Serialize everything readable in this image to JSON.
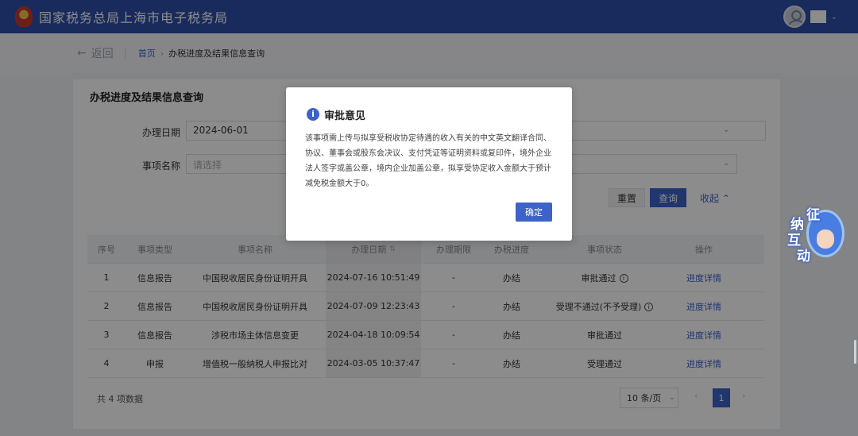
{
  "header": {
    "title": "国家税务总局上海市电子税务局",
    "user_caret": "⌄"
  },
  "breadcrumb": {
    "back_arrow": "←",
    "back_label": "返回",
    "home": "首页",
    "arrow": "›",
    "current": "办税进度及结果信息查询"
  },
  "card": {
    "title": "办税进度及结果信息查询",
    "date_label": "办理日期",
    "date_value": "2024-06-01",
    "item_label": "事项名称",
    "item_placeholder": "请选择",
    "reset_label": "重置",
    "query_label": "查询",
    "collapse_label": "收起 ⌃"
  },
  "table": {
    "headers": [
      "序号",
      "事项类型",
      "事项名称",
      "办理日期",
      "办理期限",
      "办税进度",
      "事项状态",
      "操作"
    ],
    "sort_icon": "⇅",
    "rows": [
      {
        "no": "1",
        "type": "信息报告",
        "name": "中国税收居民身份证明开具",
        "date": "2024-07-16 10:51:49",
        "limit": "-",
        "progress": "办结",
        "status": "审批通过",
        "info": true,
        "action": "进度详情"
      },
      {
        "no": "2",
        "type": "信息报告",
        "name": "中国税收居民身份证明开具",
        "date": "2024-07-09 12:23:43",
        "limit": "-",
        "progress": "办结",
        "status": "受理不通过(不予受理)",
        "info": true,
        "action": "进度详情"
      },
      {
        "no": "3",
        "type": "信息报告",
        "name": "涉税市场主体信息变更",
        "date": "2024-04-18 10:09:54",
        "limit": "-",
        "progress": "办结",
        "status": "审批通过",
        "info": false,
        "action": "进度详情"
      },
      {
        "no": "4",
        "type": "申报",
        "name": "增值税一般纳税人申报比对",
        "date": "2024-03-05 10:37:47",
        "limit": "-",
        "progress": "办结",
        "status": "受理通过",
        "info": false,
        "action": "进度详情"
      }
    ],
    "info_glyph": "i"
  },
  "footer": {
    "total": "共 4 项数据",
    "page_size": "10 条/页",
    "page_size_caret": "⌄",
    "prev": "‹",
    "page": "1",
    "next": "›"
  },
  "mascot": {
    "chars": [
      "征",
      "纳",
      "互",
      "动"
    ]
  },
  "modal": {
    "icon": "i",
    "title": "审批意见",
    "body": "该事项需上传与拟享受税收协定待遇的收入有关的中文英文翻译合同、协议、董事会或股东会决议、支付凭证等证明资料或复印件，境外企业法人签字或盖公章，境内企业加盖公章，拟享受协定收入金额大于预计减免税金额大于0。",
    "ok_label": "确定"
  },
  "colors": {
    "header": "#2f4fa8",
    "accent": "#3d62c8"
  }
}
